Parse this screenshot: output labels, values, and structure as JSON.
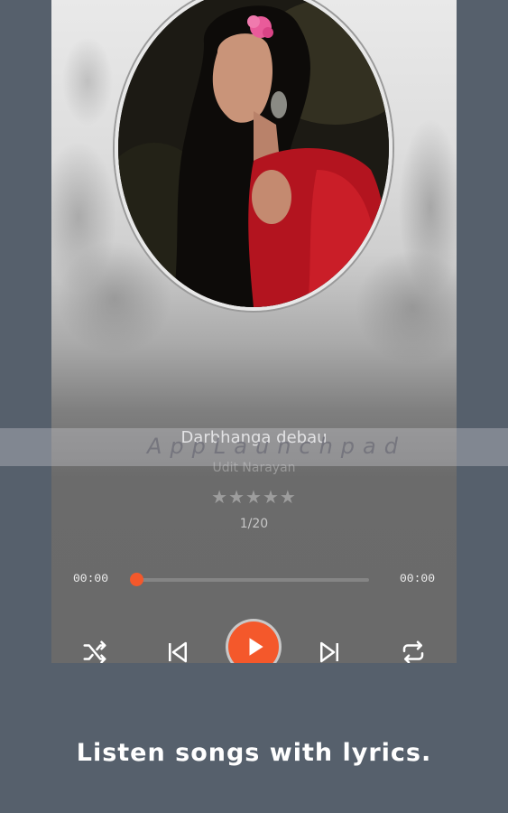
{
  "player": {
    "song_title": "Darbhanga debau",
    "artist": "Udit Narayan",
    "rating_stars": "★★★★★",
    "rating_value": 0,
    "track_position": "1/20",
    "time_elapsed": "00:00",
    "time_total": "00:00",
    "progress": 0
  },
  "controls": {
    "shuffle": "shuffle-icon",
    "previous": "skip-previous-icon",
    "play": "play-icon",
    "next": "skip-next-icon",
    "repeat": "repeat-icon"
  },
  "watermark": "AppLaunchpad",
  "caption": "Listen songs with lyrics.",
  "colors": {
    "accent": "#f4582b",
    "background": "#56606c"
  }
}
